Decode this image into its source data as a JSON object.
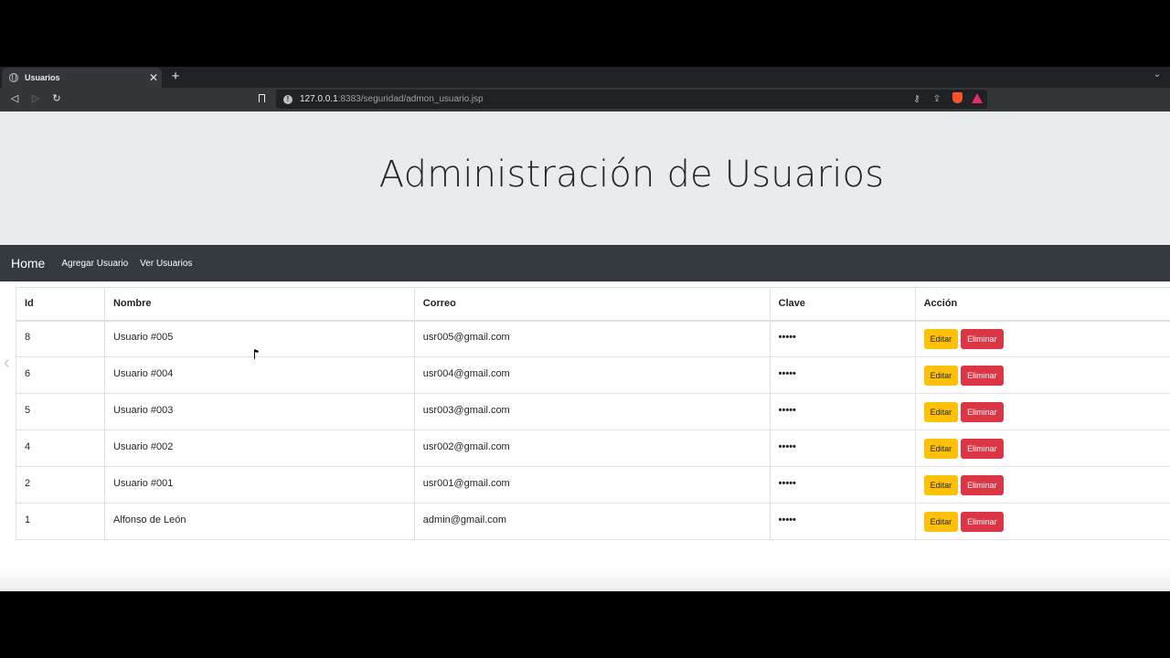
{
  "browser": {
    "tab_title": "Usuarios",
    "tab_close": "✕",
    "new_tab": "+",
    "url_host": "127.0.0.1",
    "url_rest": ":8383/seguridad/admon_usuario.jsp"
  },
  "page": {
    "title": "Administración de Usuarios"
  },
  "navbar": {
    "brand": "Home",
    "links": [
      "Agregar Usuario",
      "Ver Usuarios"
    ]
  },
  "table": {
    "headers": [
      "Id",
      "Nombre",
      "Correo",
      "Clave",
      "Acción"
    ],
    "rows": [
      {
        "id": "8",
        "nombre": "Usuario #005",
        "correo": "usr005@gmail.com",
        "clave": "•••••"
      },
      {
        "id": "6",
        "nombre": "Usuario #004",
        "correo": "usr004@gmail.com",
        "clave": "•••••"
      },
      {
        "id": "5",
        "nombre": "Usuario #003",
        "correo": "usr003@gmail.com",
        "clave": "•••••"
      },
      {
        "id": "4",
        "nombre": "Usuario #002",
        "correo": "usr002@gmail.com",
        "clave": "•••••"
      },
      {
        "id": "2",
        "nombre": "Usuario #001",
        "correo": "usr001@gmail.com",
        "clave": "•••••"
      },
      {
        "id": "1",
        "nombre": "Alfonso de León",
        "correo": "admin@gmail.com",
        "clave": "•••••"
      }
    ],
    "edit_label": "Editar",
    "delete_label": "Eliminar"
  },
  "colors": {
    "warning": "#ffc107",
    "danger": "#dc3545",
    "navbar": "#343a40",
    "jumbotron": "#e9ecef"
  }
}
